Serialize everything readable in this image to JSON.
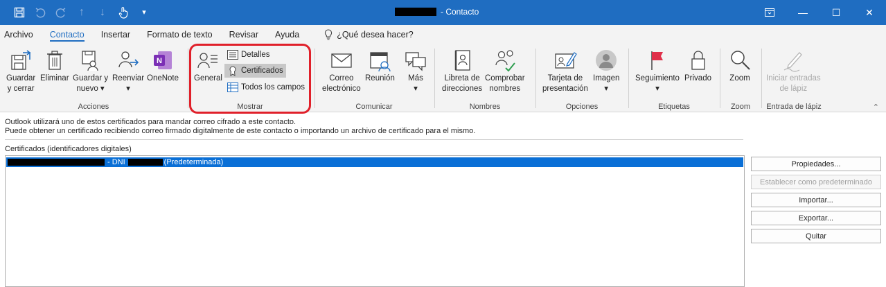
{
  "window": {
    "title_suffix": "- Contacto",
    "minimize": "—",
    "maximize": "☐",
    "close": "✕",
    "restore_ribbon": "⧉"
  },
  "qat": {
    "save": "save-icon",
    "undo": "undo-icon",
    "redo": "redo-icon",
    "up": "↑",
    "down": "↓",
    "touch": "touch-icon",
    "customize": "▾"
  },
  "tabs": [
    "Archivo",
    "Contacto",
    "Insertar",
    "Formato de texto",
    "Revisar",
    "Ayuda"
  ],
  "tell_me": "¿Qué desea hacer?",
  "ribbon": {
    "acciones": {
      "label": "Acciones",
      "save_close": [
        "Guardar",
        "y cerrar"
      ],
      "delete": "Eliminar",
      "save_new": [
        "Guardar y",
        "nuevo ▾"
      ],
      "forward": [
        "Reenviar",
        "▾"
      ],
      "onenote": "OneNote"
    },
    "mostrar": {
      "label": "Mostrar",
      "general": "General",
      "detalles": "Detalles",
      "certificados": "Certificados",
      "todos": "Todos los campos"
    },
    "comunicar": {
      "label": "Comunicar",
      "correo": [
        "Correo",
        "electrónico"
      ],
      "reunion": "Reunión",
      "mas": [
        "Más",
        "▾"
      ]
    },
    "nombres": {
      "label": "Nombres",
      "libreta": [
        "Libreta de",
        "direcciones"
      ],
      "comprobar": [
        "Comprobar",
        "nombres"
      ]
    },
    "opciones": {
      "label": "Opciones",
      "tarjeta": [
        "Tarjeta de",
        "presentación"
      ],
      "imagen": [
        "Imagen",
        "▾"
      ]
    },
    "etiquetas": {
      "label": "Etiquetas",
      "seguimiento": [
        "Seguimiento",
        "▾"
      ],
      "privado": "Privado"
    },
    "zoom": {
      "label": "Zoom",
      "zoom": "Zoom"
    },
    "lapiz": {
      "label": "Entrada de lápiz",
      "iniciar": [
        "Iniciar entradas",
        "de lápiz"
      ]
    },
    "collapse": "⌃"
  },
  "body": {
    "info_line1": "Outlook utilizará uno de estos certificados para mandar correo cifrado a este contacto.",
    "info_line2": "Puede obtener un certificado recibiendo correo firmado digitalmente de este contacto o importando un archivo de certificado para el mismo.",
    "cert_list_label": "Certificados (identificadores digitales)",
    "cert_row_mid": "- DNI",
    "cert_row_tail": "(Predeterminada)"
  },
  "buttons": {
    "propiedades": "Propiedades...",
    "establecer": "Establecer como predeterminado",
    "importar": "Importar...",
    "exportar": "Exportar...",
    "quitar": "Quitar"
  },
  "colors": {
    "titlebar": "#1f6dc1",
    "selection": "#0a6fd6",
    "highlight": "#e0202a",
    "onenote": "#7b2fb5",
    "flag": "#e0304a"
  }
}
